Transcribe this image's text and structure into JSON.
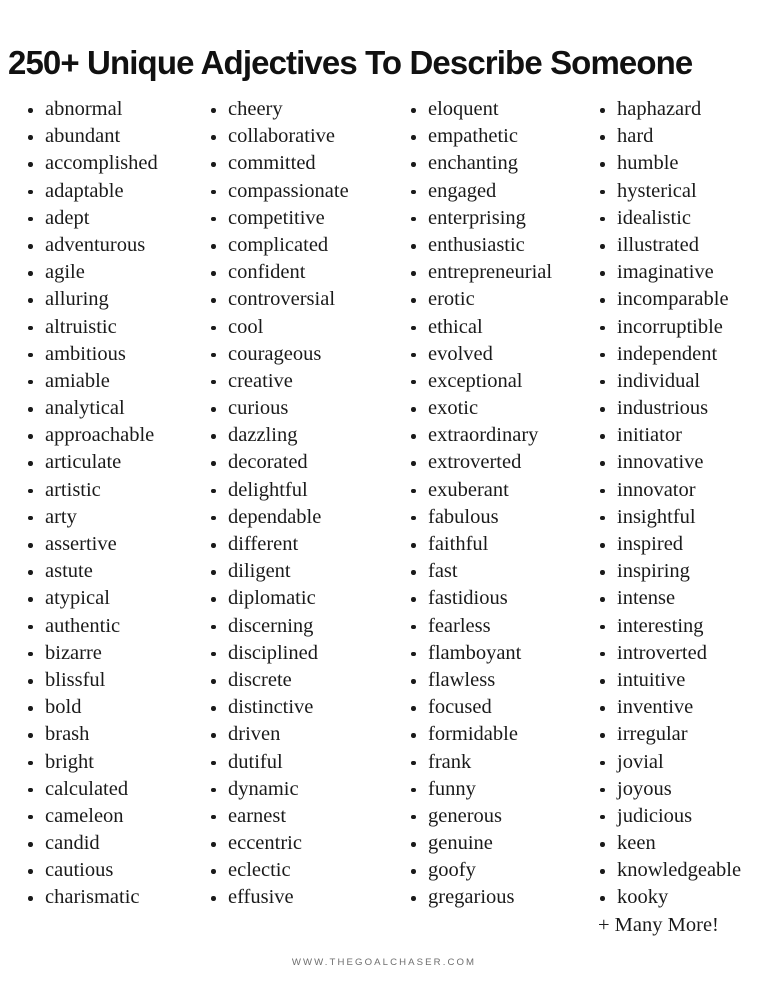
{
  "page": {
    "title": "250+ Unique Adjectives To Describe Someone",
    "background_color": "#ffffff",
    "text_color": "#1a1a1a",
    "footer_color": "#6e6e6e"
  },
  "footer": {
    "site": "WWW.THEGOALCHASER.COM"
  },
  "columns": [
    {
      "name": "column-1",
      "items": [
        "abnormal",
        "abundant",
        "accomplished",
        "adaptable",
        "adept",
        "adventurous",
        "agile",
        "alluring",
        "altruistic",
        "ambitious",
        "amiable",
        "analytical",
        "approachable",
        "articulate",
        "artistic",
        "arty",
        "assertive",
        "astute",
        "atypical",
        "authentic",
        "bizarre",
        "blissful",
        "bold",
        "brash",
        "bright",
        "calculated",
        "cameleon",
        "candid",
        "cautious",
        "charismatic"
      ],
      "extra": ""
    },
    {
      "name": "column-2",
      "items": [
        "cheery",
        "collaborative",
        "committed",
        "compassionate",
        "competitive",
        "complicated",
        "confident",
        "controversial",
        "cool",
        "courageous",
        "creative",
        "curious",
        "dazzling",
        "decorated",
        "delightful",
        "dependable",
        "different",
        "diligent",
        "diplomatic",
        "discerning",
        "disciplined",
        "discrete",
        "distinctive",
        "driven",
        "dutiful",
        "dynamic",
        "earnest",
        "eccentric",
        "eclectic",
        "effusive"
      ],
      "extra": ""
    },
    {
      "name": "column-3",
      "items": [
        "eloquent",
        "empathetic",
        "enchanting",
        "engaged",
        "enterprising",
        "enthusiastic",
        "entrepreneurial",
        "erotic",
        "ethical",
        "evolved",
        "exceptional",
        "exotic",
        "extraordinary",
        "extroverted",
        "exuberant",
        "fabulous",
        "faithful",
        "fast",
        "fastidious",
        "fearless",
        "flamboyant",
        "flawless",
        "focused",
        "formidable",
        "frank",
        "funny",
        "generous",
        "genuine",
        "goofy",
        "gregarious"
      ],
      "extra": ""
    },
    {
      "name": "column-4",
      "items": [
        "haphazard",
        "hard",
        "humble",
        "hysterical",
        "idealistic",
        "illustrated",
        "imaginative",
        "incomparable",
        "incorruptible",
        "independent",
        "individual",
        "industrious",
        "initiator",
        "innovative",
        "innovator",
        "insightful",
        "inspired",
        "inspiring",
        "intense",
        "interesting",
        "introverted",
        "intuitive",
        "inventive",
        "irregular",
        "jovial",
        "joyous",
        "judicious",
        "keen",
        "knowledgeable",
        "kooky"
      ],
      "extra": "+ Many More!"
    }
  ]
}
